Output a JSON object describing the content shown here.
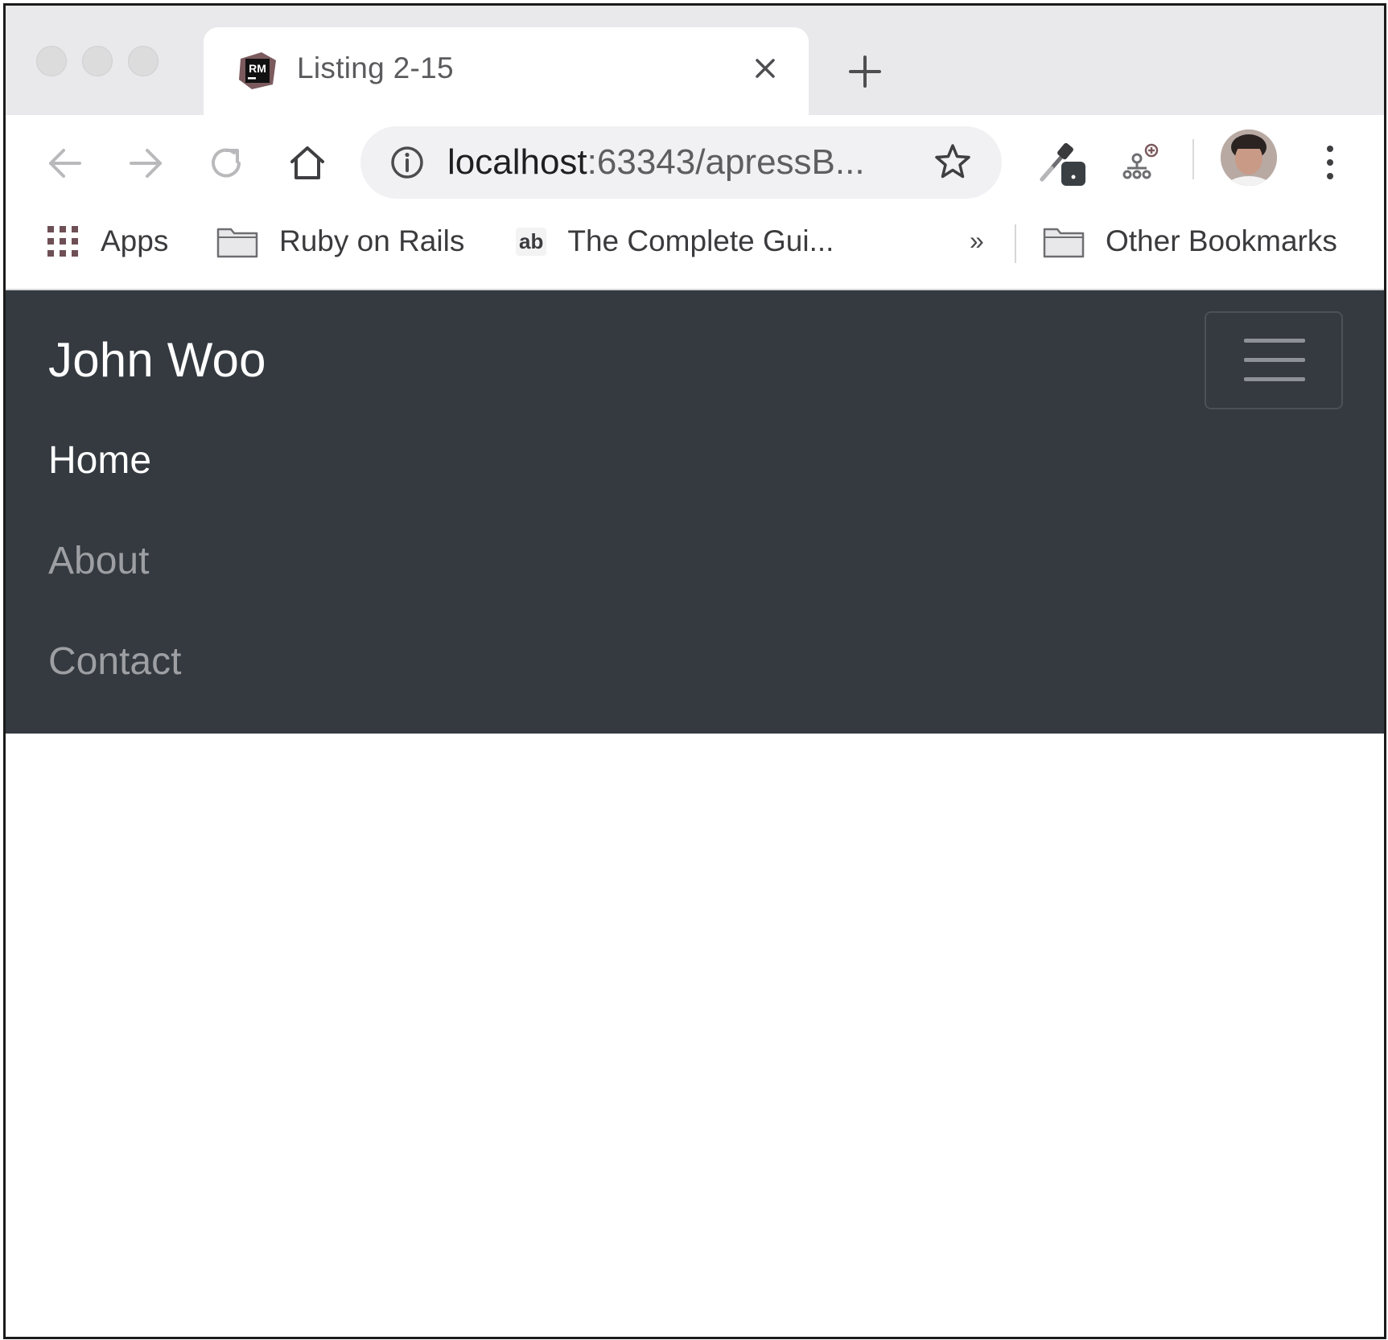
{
  "browser": {
    "tab": {
      "title": "Listing 2-15",
      "favicon_text": "RM"
    },
    "toolbar": {
      "url_host": "localhost",
      "url_rest": ":63343/apressB..."
    },
    "bookmarks": [
      {
        "label": "Apps",
        "icon": "apps-grid-icon"
      },
      {
        "label": "Ruby on Rails",
        "icon": "folder-icon"
      },
      {
        "label": "The Complete Gui...",
        "icon": "ab-site-icon",
        "icon_text": "ab"
      }
    ],
    "bookmarks_overflow": "»",
    "other_bookmarks": {
      "label": "Other Bookmarks",
      "icon": "folder-icon"
    }
  },
  "page": {
    "brand": "John Woo",
    "nav_links": [
      {
        "label": "Home",
        "active": true
      },
      {
        "label": "About",
        "active": false
      },
      {
        "label": "Contact",
        "active": false
      }
    ],
    "navbar_color": "#343a40"
  }
}
